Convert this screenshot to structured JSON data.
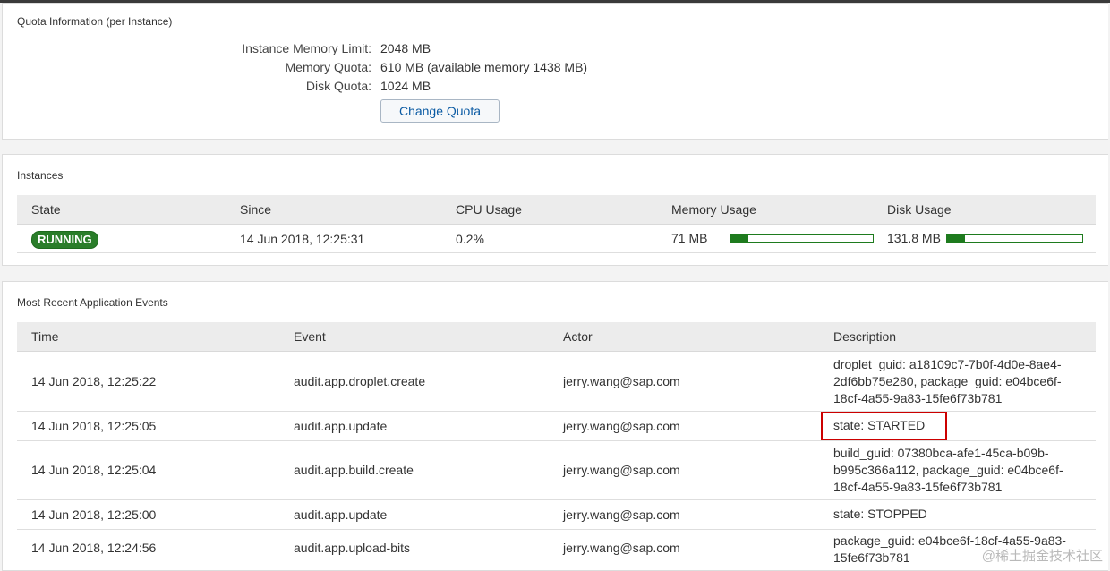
{
  "quota": {
    "title": "Quota Information (per Instance)",
    "rows": [
      {
        "label": "Instance Memory Limit:",
        "value": "2048 MB"
      },
      {
        "label": "Memory Quota:",
        "value": "610 MB (available memory 1438 MB)"
      },
      {
        "label": "Disk Quota:",
        "value": "1024 MB"
      }
    ],
    "change_button": "Change Quota"
  },
  "instances": {
    "title": "Instances",
    "columns": [
      "State",
      "Since",
      "CPU Usage",
      "Memory Usage",
      "Disk Usage"
    ],
    "row": {
      "state": "RUNNING",
      "since": "14 Jun 2018, 12:25:31",
      "cpu": "0.2%",
      "memory": "71 MB",
      "memory_fraction": 0.12,
      "disk": "131.8 MB",
      "disk_fraction": 0.13
    }
  },
  "events": {
    "title": "Most Recent Application Events",
    "columns": [
      "Time",
      "Event",
      "Actor",
      "Description"
    ],
    "rows": [
      {
        "time": "14 Jun 2018, 12:25:22",
        "event": "audit.app.droplet.create",
        "actor": "jerry.wang@sap.com",
        "desc": [
          "droplet_guid: a18109c7-7b0f-4d0e-8ae4-",
          "2df6bb75e280, package_guid: e04bce6f-",
          "18cf-4a55-9a83-15fe6f73b781"
        ]
      },
      {
        "time": "14 Jun 2018, 12:25:05",
        "event": "audit.app.update",
        "actor": "jerry.wang@sap.com",
        "desc": [
          "state: STARTED"
        ]
      },
      {
        "time": "14 Jun 2018, 12:25:04",
        "event": "audit.app.build.create",
        "actor": "jerry.wang@sap.com",
        "desc": [
          "build_guid: 07380bca-afe1-45ca-b09b-",
          "b995c366a112, package_guid: e04bce6f-",
          "18cf-4a55-9a83-15fe6f73b781"
        ]
      },
      {
        "time": "14 Jun 2018, 12:25:00",
        "event": "audit.app.update",
        "actor": "jerry.wang@sap.com",
        "desc": [
          "state: STOPPED"
        ]
      },
      {
        "time": "14 Jun 2018, 12:24:56",
        "event": "audit.app.upload-bits",
        "actor": "jerry.wang@sap.com",
        "desc": [
          "package_guid: e04bce6f-18cf-4a55-9a83-",
          "15fe6f73b781"
        ]
      }
    ]
  },
  "watermark": "@稀土掘金技术社区",
  "colors": {
    "running": "#2a7d2a",
    "meter": "#1e7b1e",
    "highlight": "#cc0000",
    "link": "#0a5aa3"
  }
}
